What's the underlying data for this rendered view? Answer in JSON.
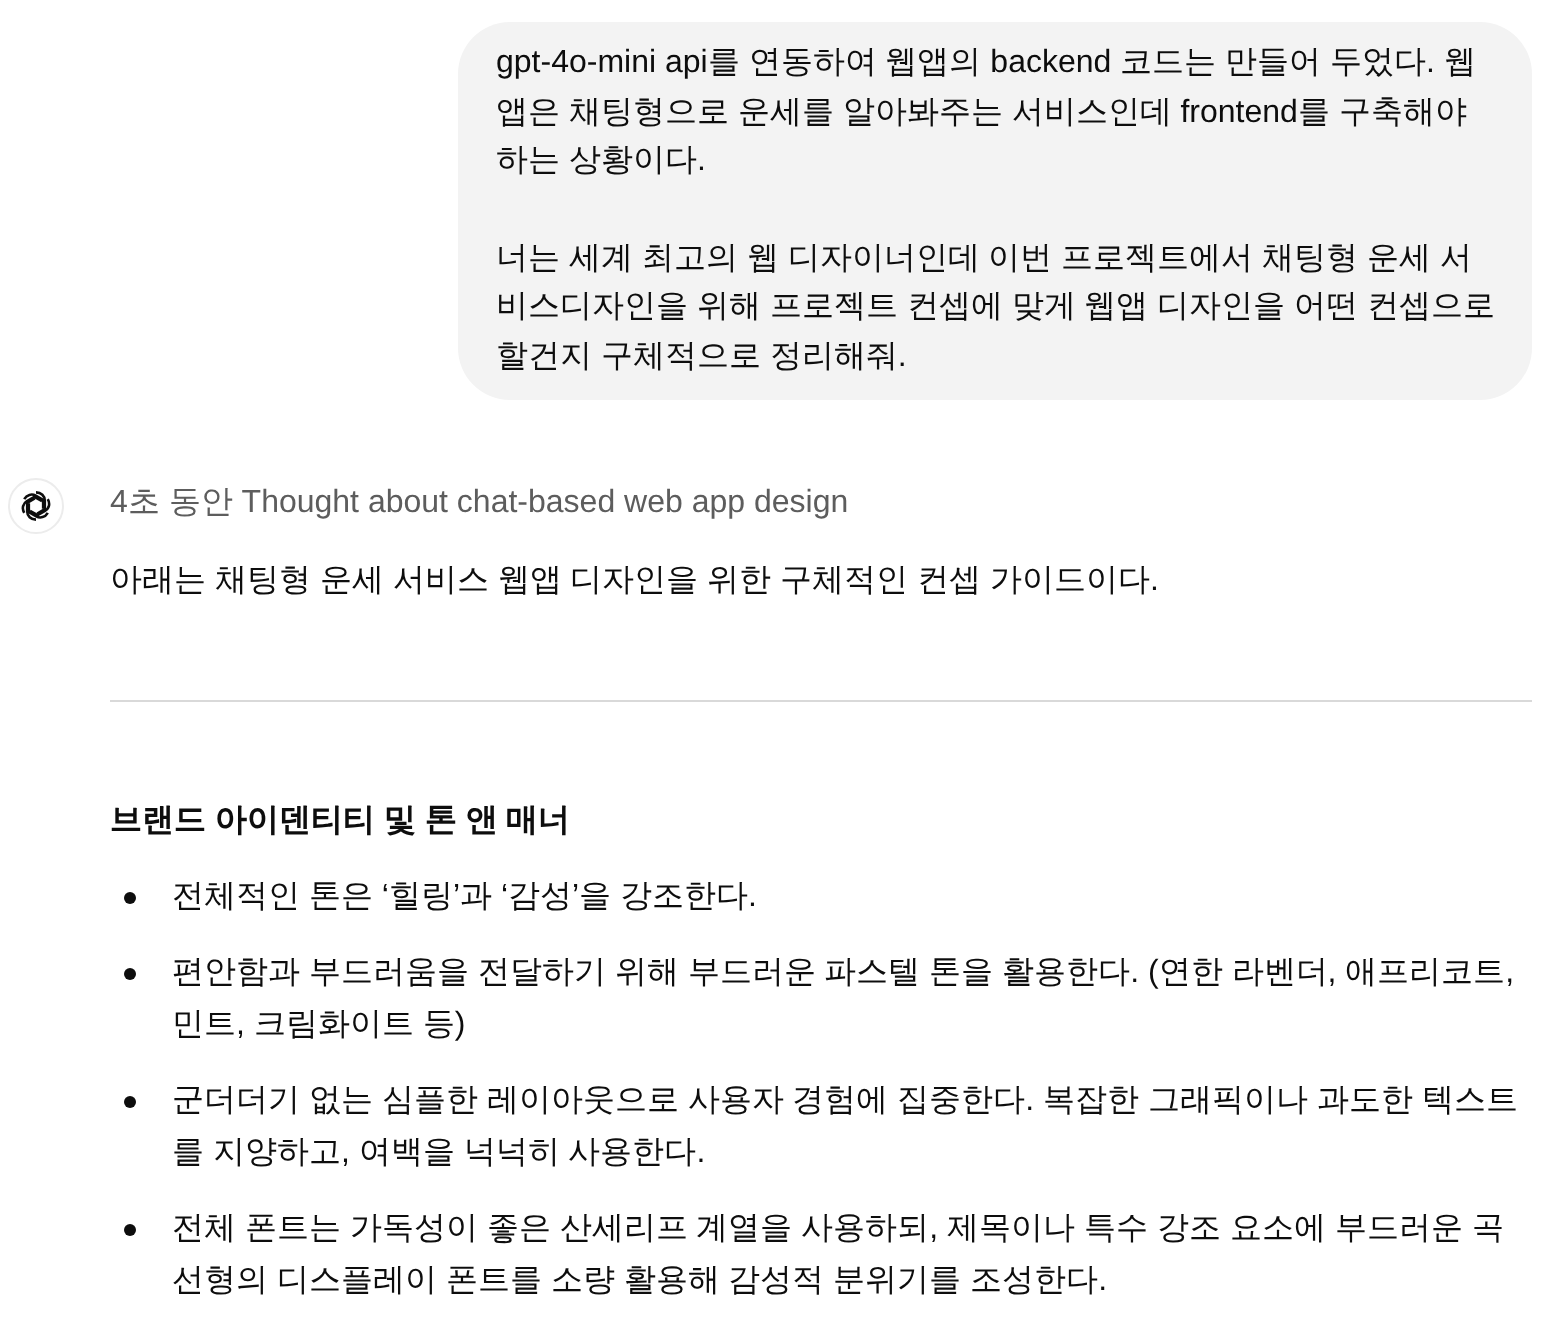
{
  "user_message": {
    "paragraphs": [
      "gpt-4o-mini api를 연동하여 웹앱의 backend 코드는 만들어 두었다. 웹앱은 채팅형으로 운세를 알아봐주는 서비스인데 frontend를 구축해야 하는 상황이다.",
      "너는 세계 최고의 웹 디자이너인데 이번 프로젝트에서 채팅형 운세 서비스디자인을 위해 프로젝트 컨셉에 맞게 웹앱 디자인을 어떤 컨셉으로 할건지 구체적으로 정리해줘."
    ]
  },
  "assistant_message": {
    "thought": "4초 동안 Thought about chat-based web app design",
    "intro": "아래는 채팅형 운세 서비스 웹앱 디자인을 위한 구체적인 컨셉 가이드이다.",
    "section": {
      "heading": "브랜드 아이덴티티 및 톤 앤 매너",
      "bullets": [
        "전체적인 톤은 ‘힐링’과 ‘감성’을 강조한다.",
        "편안함과 부드러움을 전달하기 위해 부드러운 파스텔 톤을 활용한다. (연한 라벤더, 애프리코트, 민트, 크림화이트 등)",
        "군더더기 없는 심플한 레이아웃으로 사용자 경험에 집중한다. 복잡한 그래픽이나 과도한 텍스트를 지양하고, 여백을 넉넉히 사용한다.",
        "전체 폰트는 가독성이 좋은 산세리프 계열을 사용하되, 제목이나 특수 강조 요소에 부드러운 곡선형의 디스플레이 폰트를 소량 활용해 감성적 분위기를 조성한다."
      ]
    }
  }
}
